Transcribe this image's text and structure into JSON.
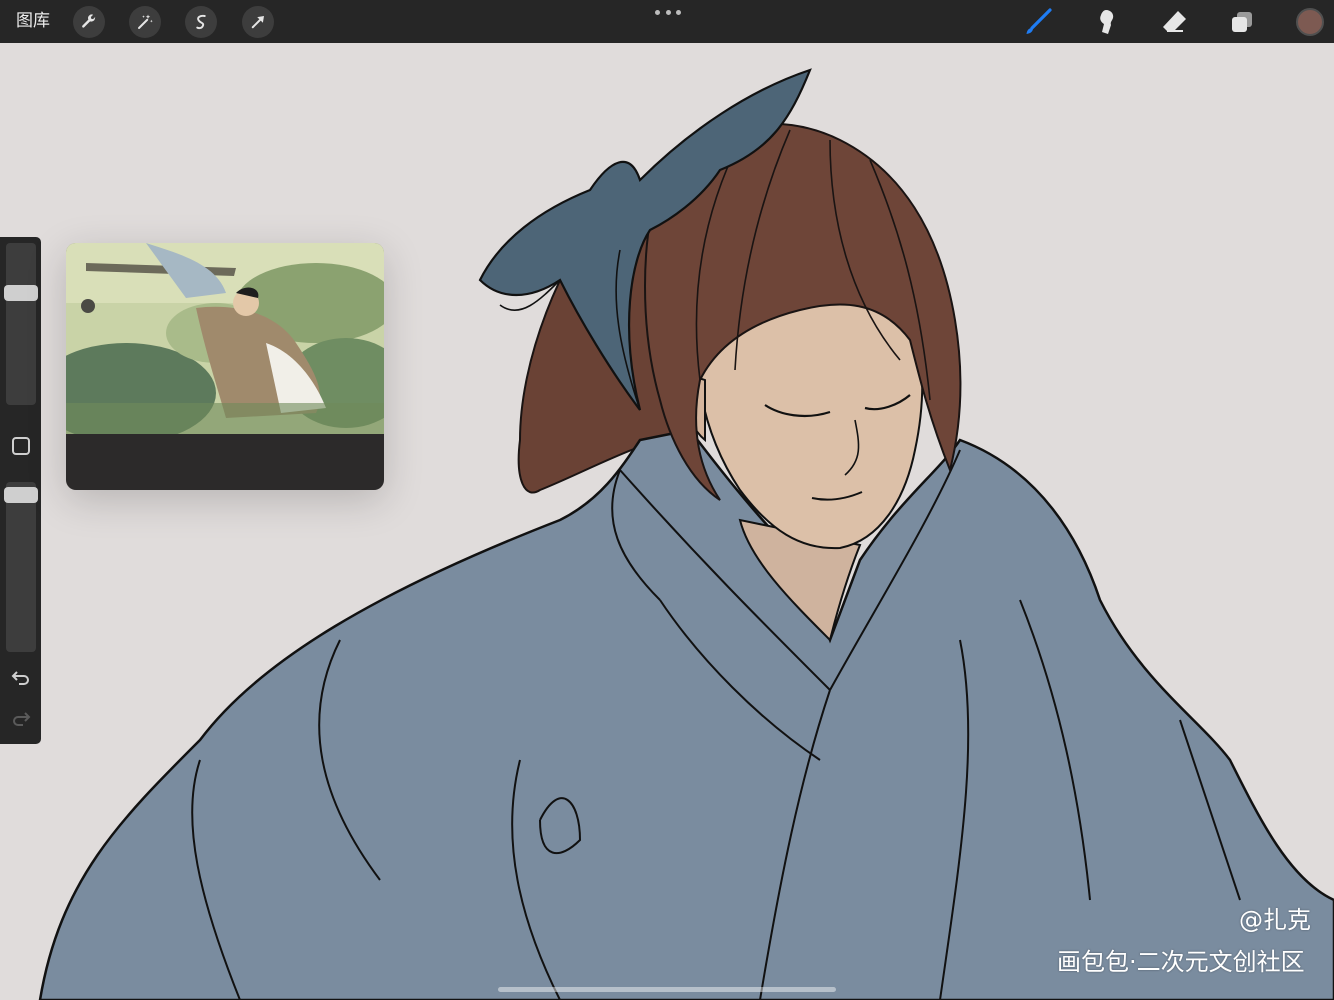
{
  "toolbar": {
    "gallery_label": "图库",
    "left_tools": [
      "wrench-icon",
      "magic-wand-icon",
      "selection-icon",
      "transform-arrow-icon"
    ],
    "right_tools": [
      "brush-icon",
      "smudge-icon",
      "eraser-icon",
      "layers-icon"
    ],
    "current_color": "#7d5a52",
    "active_tool_color": "#1f7cf2"
  },
  "sidebar": {
    "brush_size_level": 0.3,
    "opacity_level": 0.92
  },
  "watermark": {
    "handle": "@扎克",
    "site": "画包包·二次元文创社区"
  },
  "colors": {
    "canvas_bg": "#e0dcdb",
    "robe": "#7a8c9f",
    "ribbon": "#4d6577",
    "hair": "#6e4538",
    "skin": "#dcc0a8"
  }
}
